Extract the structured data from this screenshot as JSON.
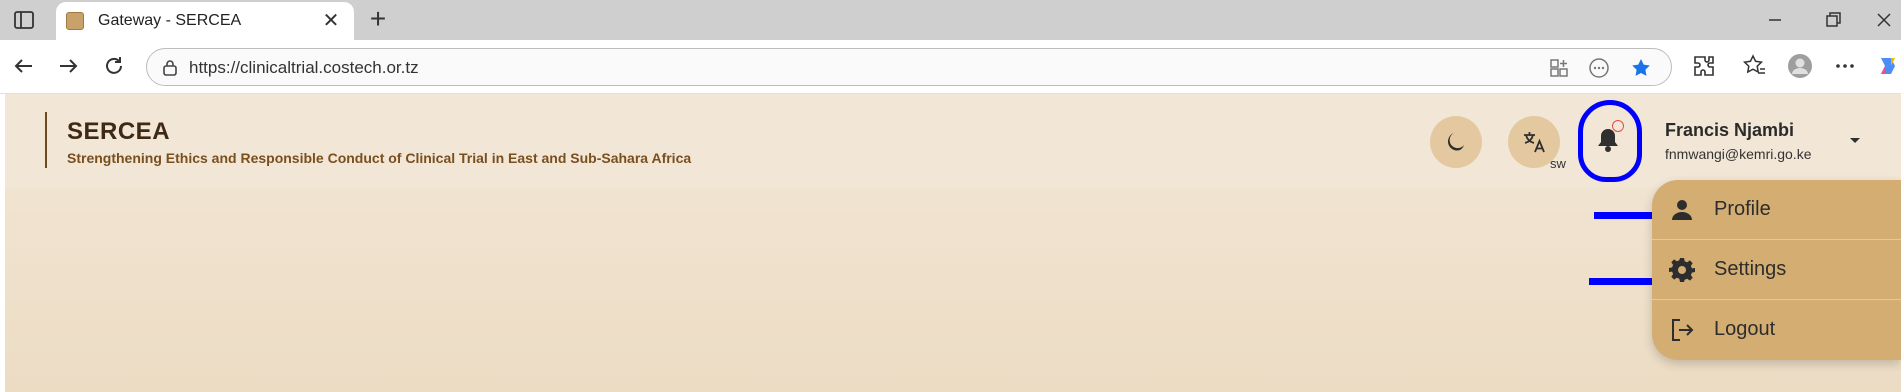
{
  "browser": {
    "tab": {
      "title": "Gateway - SERCEA"
    },
    "address": {
      "url": "https://clinicaltrial.costech.or.tz"
    }
  },
  "app": {
    "brand": {
      "title": "SERCEA",
      "subtitle": "Strengthening Ethics and Responsible Conduct of Clinical Trial in East and Sub-Sahara Africa"
    },
    "language": {
      "code": "sw"
    },
    "user": {
      "name": "Francis Njambi",
      "email": "fnmwangi@kemri.go.ke"
    },
    "menu": [
      {
        "label": "Profile",
        "icon": "person-icon"
      },
      {
        "label": "Settings",
        "icon": "gear-icon"
      },
      {
        "label": "Logout",
        "icon": "logout-icon"
      }
    ]
  },
  "colors": {
    "header_bg": "#f2e6d6",
    "icon_button_bg": "#e4c89f",
    "dropdown_bg": "#d4ad72",
    "brand_text": "#3e2a14",
    "subtitle_text": "#7a4f1e",
    "annotation": "#0000ff"
  }
}
